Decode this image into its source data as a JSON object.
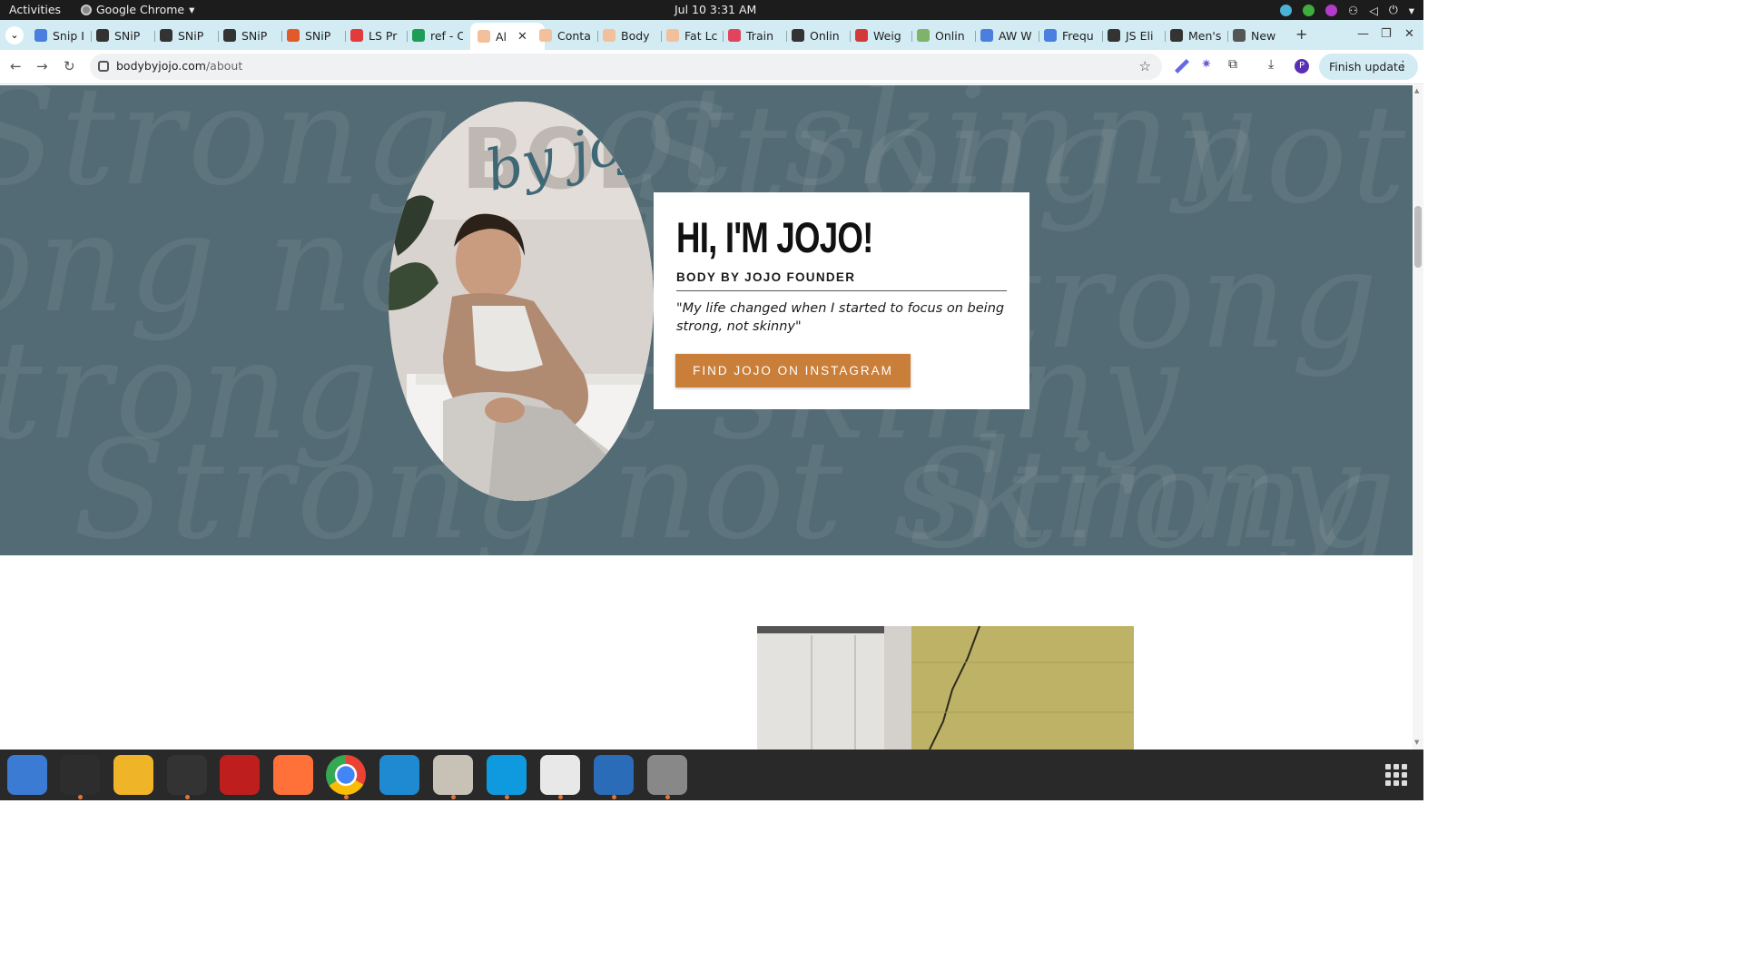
{
  "system_bar": {
    "activities": "Activities",
    "app_name": "Google Chrome",
    "clock": "Jul 10  3:31 AM"
  },
  "tabs": [
    {
      "label": "Snip I",
      "favicon_color": "#4a7fe0"
    },
    {
      "label": "SNiP",
      "favicon_color": "#333333"
    },
    {
      "label": "SNiP",
      "favicon_color": "#333333"
    },
    {
      "label": "SNiP",
      "favicon_color": "#333333"
    },
    {
      "label": "SNiP",
      "favicon_color": "#e05a2a"
    },
    {
      "label": "LS Pr",
      "favicon_color": "#e23b3b"
    },
    {
      "label": "ref - C",
      "favicon_color": "#1e9d57"
    },
    {
      "label": "Al",
      "favicon_color": "#f2c09a",
      "active": true
    },
    {
      "label": "Conta",
      "favicon_color": "#f2c09a"
    },
    {
      "label": "Body",
      "favicon_color": "#f2c09a"
    },
    {
      "label": "Fat Lc",
      "favicon_color": "#f2c09a"
    },
    {
      "label": "Train",
      "favicon_color": "#e0455e"
    },
    {
      "label": "Onlin",
      "favicon_color": "#333333"
    },
    {
      "label": "Weig",
      "favicon_color": "#d23a3a"
    },
    {
      "label": "Onlin",
      "favicon_color": "#7fb36a"
    },
    {
      "label": "AW W",
      "favicon_color": "#4a7fe0"
    },
    {
      "label": "Frequ",
      "favicon_color": "#4a7fe0"
    },
    {
      "label": "JS Eli",
      "favicon_color": "#333333"
    },
    {
      "label": "Men's",
      "favicon_color": "#333333"
    },
    {
      "label": "New",
      "favicon_color": "#555555"
    }
  ],
  "omnibox": {
    "domain": "bodybyjojo.com",
    "path": "/about"
  },
  "toolbar": {
    "finish_update": "Finish update",
    "profile_initial": "P"
  },
  "hero": {
    "background_script": "Strong not skinny",
    "portrait_logo": "BODY",
    "portrait_logo_script": "by jojo",
    "heading": "HI, I'M JOJO!",
    "subheading": "BODY BY JOJO FOUNDER",
    "quote": "\"My life changed when I started to focus on being strong, not skinny\"",
    "cta": "FIND JOJO ON INSTAGRAM"
  },
  "colors": {
    "hero_bg": "#536b74",
    "cta_bg": "#c97f3a",
    "tab_strip": "#d3ebf3",
    "dock_bg": "#2a2929"
  },
  "dock": [
    {
      "icon": "thunderbird-icon"
    },
    {
      "icon": "terminal-icon"
    },
    {
      "icon": "calculator-icon"
    },
    {
      "icon": "system-monitor-icon"
    },
    {
      "icon": "filezilla-icon"
    },
    {
      "icon": "firefox-icon"
    },
    {
      "icon": "chrome-icon"
    },
    {
      "icon": "vscode-icon"
    },
    {
      "icon": "files-icon"
    },
    {
      "icon": "skype-icon"
    },
    {
      "icon": "text-editor-icon"
    },
    {
      "icon": "document-viewer-icon"
    },
    {
      "icon": "disk-icon"
    }
  ]
}
